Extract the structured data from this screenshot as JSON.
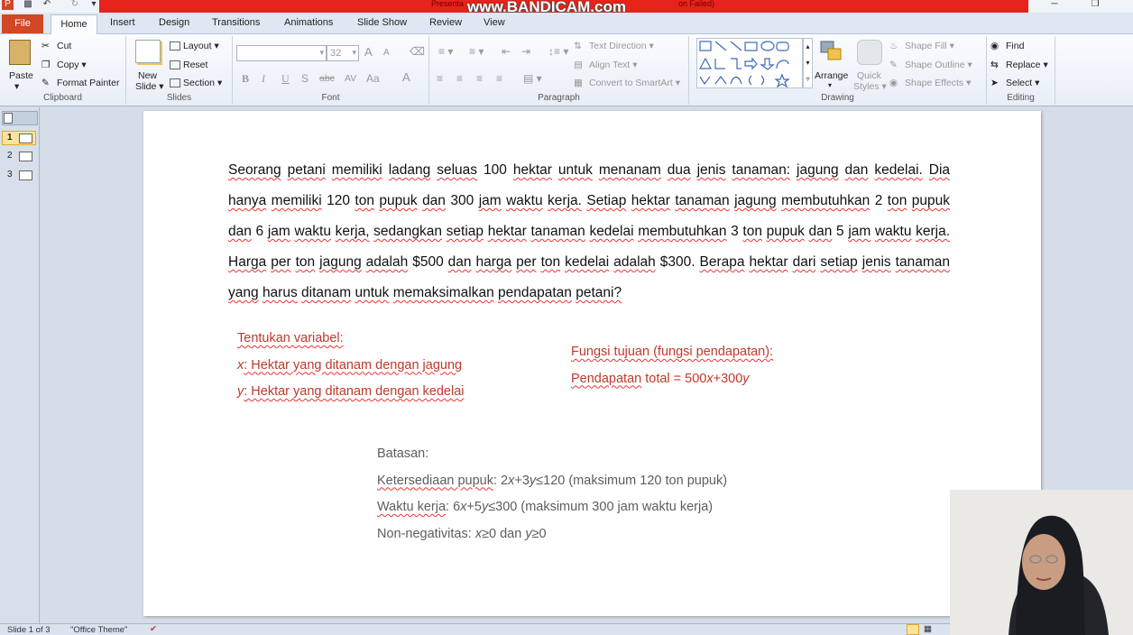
{
  "titlebar": {
    "title": "Presenta",
    "status": "on Failed)",
    "watermark": "www.BANDICAM.com",
    "qat_icons": [
      "powerpoint-logo",
      "save-icon",
      "undo-icon",
      "redo-icon",
      "customize-qat-icon"
    ]
  },
  "tabs": [
    "File",
    "Home",
    "Insert",
    "Design",
    "Transitions",
    "Animations",
    "Slide Show",
    "Review",
    "View"
  ],
  "ribbon": {
    "clipboard": {
      "label": "Clipboard",
      "paste": "Paste",
      "cut": "Cut",
      "copy": "Copy",
      "format_painter": "Format Painter"
    },
    "slides": {
      "label": "Slides",
      "new_slide": "New",
      "new_slide2": "Slide",
      "layout": "Layout",
      "reset": "Reset",
      "section": "Section"
    },
    "font": {
      "label": "Font",
      "font_name": "",
      "font_size": "32",
      "bold": "B",
      "italic": "I",
      "underline": "U",
      "shadow": "S",
      "strike": "abc",
      "spacing": "AV",
      "case": "Aa",
      "color": "A",
      "grow": "A",
      "shrink": "A"
    },
    "paragraph": {
      "label": "Paragraph",
      "text_direction": "Text Direction",
      "align_text": "Align Text",
      "smartart": "Convert to SmartArt"
    },
    "drawing": {
      "label": "Drawing",
      "arrange": "Arrange",
      "quick": "Quick",
      "styles": "Styles",
      "shape_fill": "Shape Fill",
      "shape_outline": "Shape Outline",
      "shape_effects": "Shape Effects"
    },
    "editing": {
      "label": "Editing",
      "find": "Find",
      "replace": "Replace",
      "select": "Select"
    }
  },
  "thumbnails": [
    "1",
    "2",
    "3"
  ],
  "slide": {
    "problem_words": [
      "Seorang",
      "petani",
      "memiliki",
      "ladang",
      "seluas",
      "100",
      "hektar",
      "untuk",
      "menanam",
      "dua",
      "jenis",
      "tanaman:",
      "jagung",
      "dan",
      "kedelai.",
      "Dia",
      "hanya",
      "memiliki",
      "120",
      "ton",
      "pupuk",
      "dan",
      "300",
      "jam",
      "waktu",
      "kerja.",
      "Setiap",
      "hektar",
      "tanaman",
      "jagung",
      "membutuhkan",
      "2",
      "ton",
      "pupuk",
      "dan",
      "6",
      "jam",
      "waktu",
      "kerja,",
      "sedangkan",
      "setiap",
      "hektar",
      "tanaman",
      "kedelai",
      "membutuhkan",
      "3",
      "ton",
      "pupuk",
      "dan",
      "5",
      "jam",
      "waktu",
      "kerja.",
      "Harga",
      "per",
      "ton",
      "jagung",
      "adalah",
      "$500",
      "dan",
      "harga",
      "per",
      "ton",
      "kedelai",
      "adalah",
      "$300.",
      "Berapa",
      "hektar",
      "dari",
      "setiap",
      "jenis",
      "tanaman",
      "yang",
      "harus",
      "ditanam",
      "untuk",
      "memaksimalkan",
      "pendapatan",
      "petani?"
    ],
    "variables": {
      "title": "Tentukan variabel:",
      "x_var": "x",
      "x_text": ": Hektar yang ditanam dengan jagung",
      "y_var": "y",
      "y_text": ": Hektar yang ditanam dengan kedelai"
    },
    "objective": {
      "title": "Fungsi tujuan (fungsi pendapatan):",
      "label": "Pendapatan",
      "expr_a": " total = 500",
      "var_x": "x",
      "expr_b": "+300",
      "var_y": "y"
    },
    "constraints": {
      "title": "Batasan:",
      "c1_label": "Ketersediaan pupuk",
      "c1_a": ": 2",
      "c1_x": "x",
      "c1_b": "+3",
      "c1_y": "y",
      "c1_c": "≤120 (maksimum 120 ton pupuk)",
      "c2_label": "Waktu kerja",
      "c2_a": ": 6",
      "c2_x": "x",
      "c2_b": "+5",
      "c2_y": "y",
      "c2_c": "≤300 (maksimum 300 jam waktu kerja)",
      "c3_label": "Non-negativitas: ",
      "c3_x": "x",
      "c3_a": "≥0 dan ",
      "c3_y": "y",
      "c3_b": "≥0"
    }
  },
  "statusbar": {
    "slide_count": "Slide 1 of 3",
    "theme": "\"Office Theme\""
  }
}
